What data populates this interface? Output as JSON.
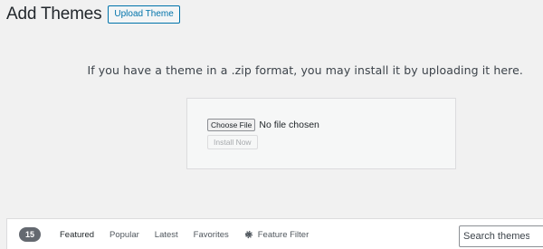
{
  "header": {
    "title": "Add Themes",
    "upload_label": "Upload Theme"
  },
  "upload": {
    "instructions": "If you have a theme in a .zip format, you may install it by uploading it here.",
    "choose_file_label": "Choose File",
    "file_status": "No file chosen",
    "install_label": "Install Now"
  },
  "filter_bar": {
    "count": "15",
    "links": [
      {
        "label": "Featured",
        "current": true
      },
      {
        "label": "Popular"
      },
      {
        "label": "Latest"
      },
      {
        "label": "Favorites"
      }
    ],
    "feature_filter_label": "Feature Filter",
    "feature_filter_icon": "gear-icon",
    "search_placeholder": "Search themes..."
  }
}
